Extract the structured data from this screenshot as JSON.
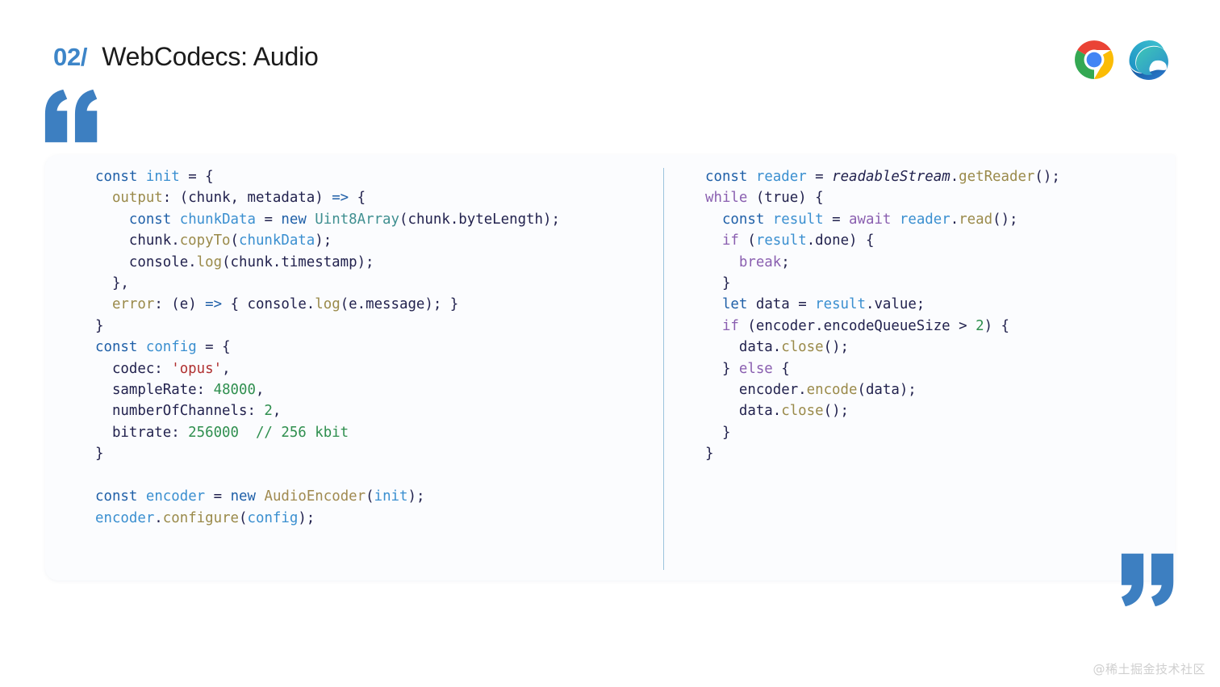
{
  "header": {
    "slide_number": "02/",
    "title": "WebCodecs: Audio",
    "number_color": "#3d85c8",
    "logos": [
      {
        "name": "chrome-logo",
        "label": "Google Chrome"
      },
      {
        "name": "edge-logo",
        "label": "Microsoft Edge"
      }
    ]
  },
  "decoration": {
    "quote_open": "“",
    "quote_close": "”",
    "quote_color": "#3d7fc1",
    "divider_color": "#9cc4dd",
    "card_background": "#fbfcfe"
  },
  "code": {
    "left": {
      "language": "javascript",
      "lines": [
        [
          {
            "t": "const",
            "c": "t-kw"
          },
          {
            "t": " ",
            "c": "t-plain"
          },
          {
            "t": "init",
            "c": "t-var"
          },
          {
            "t": " = {",
            "c": "t-plain"
          }
        ],
        [
          {
            "t": "  ",
            "c": "t-plain"
          },
          {
            "t": "output",
            "c": "t-prop"
          },
          {
            "t": ": (chunk, metadata) ",
            "c": "t-plain"
          },
          {
            "t": "=>",
            "c": "t-kw"
          },
          {
            "t": " {",
            "c": "t-plain"
          }
        ],
        [
          {
            "t": "    ",
            "c": "t-plain"
          },
          {
            "t": "const",
            "c": "t-kw"
          },
          {
            "t": " ",
            "c": "t-plain"
          },
          {
            "t": "chunkData",
            "c": "t-var"
          },
          {
            "t": " = ",
            "c": "t-plain"
          },
          {
            "t": "new",
            "c": "t-kw"
          },
          {
            "t": " ",
            "c": "t-plain"
          },
          {
            "t": "Uint8Array",
            "c": "t-type"
          },
          {
            "t": "(chunk.byteLength);",
            "c": "t-plain"
          }
        ],
        [
          {
            "t": "    chunk.",
            "c": "t-plain"
          },
          {
            "t": "copyTo",
            "c": "t-fn"
          },
          {
            "t": "(",
            "c": "t-plain"
          },
          {
            "t": "chunkData",
            "c": "t-var"
          },
          {
            "t": ");",
            "c": "t-plain"
          }
        ],
        [
          {
            "t": "    console.",
            "c": "t-plain"
          },
          {
            "t": "log",
            "c": "t-fn"
          },
          {
            "t": "(chunk.timestamp);",
            "c": "t-plain"
          }
        ],
        [
          {
            "t": "  },",
            "c": "t-plain"
          }
        ],
        [
          {
            "t": "  ",
            "c": "t-plain"
          },
          {
            "t": "error",
            "c": "t-prop"
          },
          {
            "t": ": (e) ",
            "c": "t-plain"
          },
          {
            "t": "=>",
            "c": "t-kw"
          },
          {
            "t": " { console.",
            "c": "t-plain"
          },
          {
            "t": "log",
            "c": "t-fn"
          },
          {
            "t": "(e.message); }",
            "c": "t-plain"
          }
        ],
        [
          {
            "t": "}",
            "c": "t-plain"
          }
        ],
        [
          {
            "t": "const",
            "c": "t-kw"
          },
          {
            "t": " ",
            "c": "t-plain"
          },
          {
            "t": "config",
            "c": "t-var"
          },
          {
            "t": " = {",
            "c": "t-plain"
          }
        ],
        [
          {
            "t": "  codec: ",
            "c": "t-plain"
          },
          {
            "t": "'opus'",
            "c": "t-str"
          },
          {
            "t": ",",
            "c": "t-plain"
          }
        ],
        [
          {
            "t": "  sampleRate: ",
            "c": "t-plain"
          },
          {
            "t": "48000",
            "c": "t-num"
          },
          {
            "t": ",",
            "c": "t-plain"
          }
        ],
        [
          {
            "t": "  numberOfChannels: ",
            "c": "t-plain"
          },
          {
            "t": "2",
            "c": "t-num"
          },
          {
            "t": ",",
            "c": "t-plain"
          }
        ],
        [
          {
            "t": "  bitrate: ",
            "c": "t-plain"
          },
          {
            "t": "256000",
            "c": "t-num"
          },
          {
            "t": "  ",
            "c": "t-plain"
          },
          {
            "t": "// 256 kbit",
            "c": "t-com"
          }
        ],
        [
          {
            "t": "}",
            "c": "t-plain"
          }
        ],
        [
          {
            "t": "",
            "c": "t-plain"
          }
        ],
        [
          {
            "t": "const",
            "c": "t-kw"
          },
          {
            "t": " ",
            "c": "t-plain"
          },
          {
            "t": "encoder",
            "c": "t-var"
          },
          {
            "t": " = ",
            "c": "t-plain"
          },
          {
            "t": "new",
            "c": "t-kw"
          },
          {
            "t": " ",
            "c": "t-plain"
          },
          {
            "t": "AudioEncoder",
            "c": "t-cls"
          },
          {
            "t": "(",
            "c": "t-plain"
          },
          {
            "t": "init",
            "c": "t-var"
          },
          {
            "t": ");",
            "c": "t-plain"
          }
        ],
        [
          {
            "t": "encoder",
            "c": "t-var"
          },
          {
            "t": ".",
            "c": "t-plain"
          },
          {
            "t": "configure",
            "c": "t-fn"
          },
          {
            "t": "(",
            "c": "t-plain"
          },
          {
            "t": "config",
            "c": "t-var"
          },
          {
            "t": ");",
            "c": "t-plain"
          }
        ]
      ]
    },
    "right": {
      "language": "javascript",
      "lines": [
        [
          {
            "t": "const",
            "c": "t-kw"
          },
          {
            "t": " ",
            "c": "t-plain"
          },
          {
            "t": "reader",
            "c": "t-var"
          },
          {
            "t": " = ",
            "c": "t-plain"
          },
          {
            "t": "readableStream",
            "c": "t-em"
          },
          {
            "t": ".",
            "c": "t-plain"
          },
          {
            "t": "getReader",
            "c": "t-fn"
          },
          {
            "t": "();",
            "c": "t-plain"
          }
        ],
        [
          {
            "t": "while",
            "c": "t-ctrl"
          },
          {
            "t": " (true) {",
            "c": "t-plain"
          }
        ],
        [
          {
            "t": "  ",
            "c": "t-plain"
          },
          {
            "t": "const",
            "c": "t-kw"
          },
          {
            "t": " ",
            "c": "t-plain"
          },
          {
            "t": "result",
            "c": "t-var"
          },
          {
            "t": " = ",
            "c": "t-plain"
          },
          {
            "t": "await",
            "c": "t-ctrl"
          },
          {
            "t": " ",
            "c": "t-plain"
          },
          {
            "t": "reader",
            "c": "t-var"
          },
          {
            "t": ".",
            "c": "t-plain"
          },
          {
            "t": "read",
            "c": "t-fn"
          },
          {
            "t": "();",
            "c": "t-plain"
          }
        ],
        [
          {
            "t": "  ",
            "c": "t-plain"
          },
          {
            "t": "if",
            "c": "t-ctrl"
          },
          {
            "t": " (",
            "c": "t-plain"
          },
          {
            "t": "result",
            "c": "t-var"
          },
          {
            "t": ".done) {",
            "c": "t-plain"
          }
        ],
        [
          {
            "t": "    ",
            "c": "t-plain"
          },
          {
            "t": "break",
            "c": "t-ctrl"
          },
          {
            "t": ";",
            "c": "t-plain"
          }
        ],
        [
          {
            "t": "  }",
            "c": "t-plain"
          }
        ],
        [
          {
            "t": "  ",
            "c": "t-plain"
          },
          {
            "t": "let",
            "c": "t-kw"
          },
          {
            "t": " data = ",
            "c": "t-plain"
          },
          {
            "t": "result",
            "c": "t-var"
          },
          {
            "t": ".value;",
            "c": "t-plain"
          }
        ],
        [
          {
            "t": "  ",
            "c": "t-plain"
          },
          {
            "t": "if",
            "c": "t-ctrl"
          },
          {
            "t": " (encoder.encodeQueueSize > ",
            "c": "t-plain"
          },
          {
            "t": "2",
            "c": "t-num"
          },
          {
            "t": ") {",
            "c": "t-plain"
          }
        ],
        [
          {
            "t": "    data.",
            "c": "t-plain"
          },
          {
            "t": "close",
            "c": "t-fn"
          },
          {
            "t": "();",
            "c": "t-plain"
          }
        ],
        [
          {
            "t": "  } ",
            "c": "t-plain"
          },
          {
            "t": "else",
            "c": "t-ctrl"
          },
          {
            "t": " {",
            "c": "t-plain"
          }
        ],
        [
          {
            "t": "    encoder.",
            "c": "t-plain"
          },
          {
            "t": "encode",
            "c": "t-fn"
          },
          {
            "t": "(data);",
            "c": "t-plain"
          }
        ],
        [
          {
            "t": "    data.",
            "c": "t-plain"
          },
          {
            "t": "close",
            "c": "t-fn"
          },
          {
            "t": "();",
            "c": "t-plain"
          }
        ],
        [
          {
            "t": "  }",
            "c": "t-plain"
          }
        ],
        [
          {
            "t": "}",
            "c": "t-plain"
          }
        ]
      ]
    }
  },
  "watermark": {
    "text": "@稀土掘金技术社区"
  }
}
